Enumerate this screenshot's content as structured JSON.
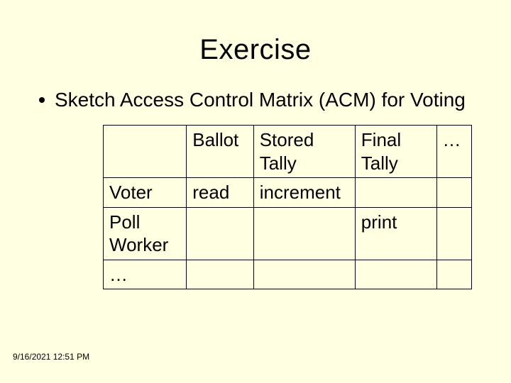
{
  "title": "Exercise",
  "bullet_text": "Sketch Access Control Matrix (ACM) for Voting",
  "table": {
    "header": {
      "c0": "",
      "c1": "Ballot",
      "c2": "Stored Tally",
      "c3": "Final Tally",
      "c4": "…"
    },
    "rows": [
      {
        "c0": "Voter",
        "c1": "read",
        "c2": "increment",
        "c3": "",
        "c4": ""
      },
      {
        "c0": "Poll Worker",
        "c1": "",
        "c2": "",
        "c3": "print",
        "c4": ""
      },
      {
        "c0": "…",
        "c1": "",
        "c2": "",
        "c3": "",
        "c4": ""
      }
    ]
  },
  "footer": "9/16/2021 12:51 PM"
}
